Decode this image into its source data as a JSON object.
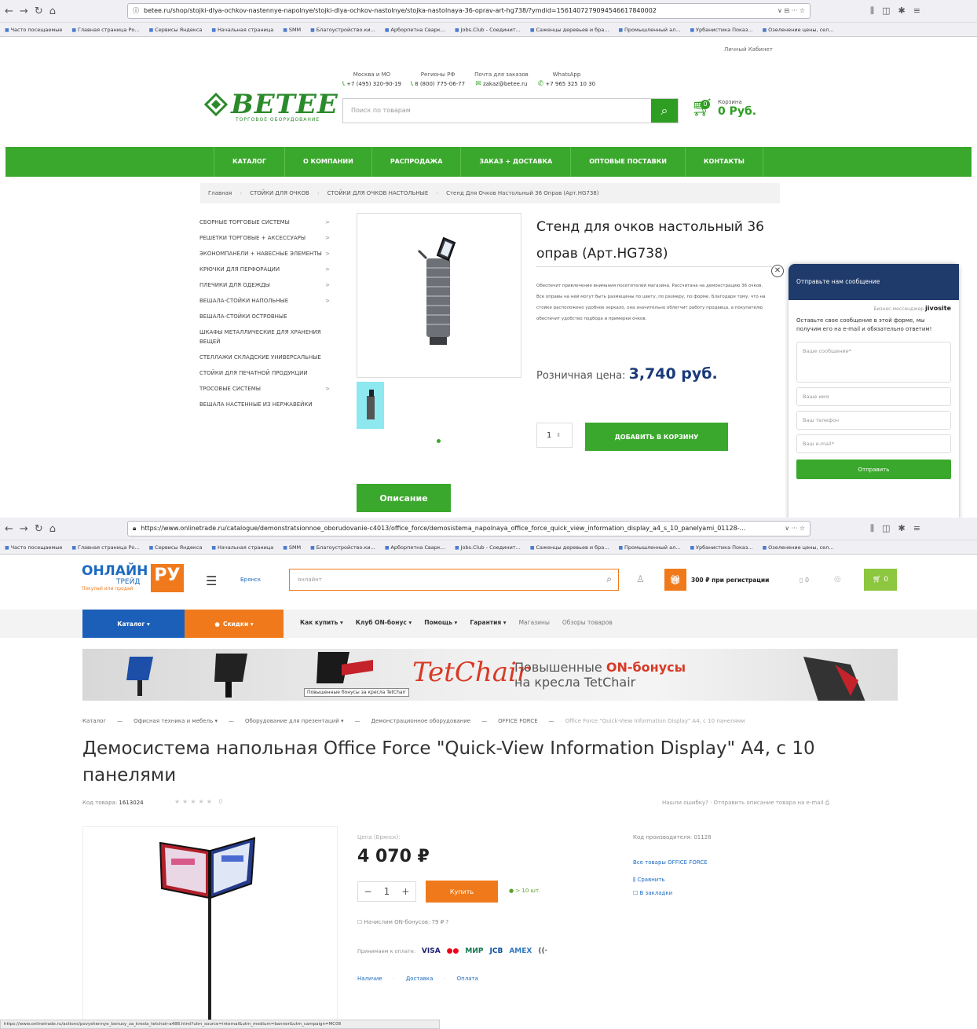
{
  "browser1": {
    "url": "betee.ru/shop/stojki-dlya-ochkov-nastennye-napolnye/stojki-dlya-ochkov-nastolnye/stojka-nastolnaya-36-oprav-art-hg738/?ymdid=1561407279094546617840002",
    "url_counter": "∨ ⊟ ··· ☆"
  },
  "bookmarks": [
    "Часто посещаемые",
    "Главная страница Ро...",
    "Сервисы Яндекса",
    "Начальная страница",
    "SMM",
    "Благоустройство.ки...",
    "Арборпетна Сварк...",
    "Jobs.Club - Соединит...",
    "Саженцы деревьев и бра...",
    "Промышленный ал...",
    "Урбанистика Показ...",
    "Озеленение цены, сел..."
  ],
  "site1": {
    "cabinet": "Личный Кабинет",
    "logo": "BETEE",
    "logo_sub": "ТОРГОВОЕ ОБОРУДОВАНИЕ",
    "contacts": [
      {
        "label": "Москва и МО",
        "value": "+7 (495) 320-90-19"
      },
      {
        "label": "Регионы РФ",
        "value": "8 (800) 775-06-77"
      },
      {
        "label": "Почта для заказов",
        "value": "zakaz@betee.ru"
      },
      {
        "label": "WhatsApp",
        "value": "+7 965 325 10 30"
      }
    ],
    "search_placeholder": "Поиск по товарам",
    "cart_label": "Корзина",
    "cart_count": "0",
    "cart_sum": "0 Руб.",
    "nav": [
      "КАТАЛОГ",
      "О КОМПАНИИ",
      "РАСПРОДАЖА",
      "ЗАКАЗ + ДОСТАВКА",
      "ОПТОВЫЕ ПОСТАВКИ",
      "КОНТАКТЫ"
    ],
    "breadcrumb": [
      "Главная",
      "СТОЙКИ ДЛЯ ОЧКОВ",
      "СТОЙКИ ДЛЯ ОЧКОВ НАСТОЛЬНЫЕ",
      "Стенд Для Очков Настольный 36 Оправ (Арт.HG738)"
    ],
    "categories": [
      {
        "label": "СБОРНЫЕ ТОРГОВЫЕ СИСТЕМЫ",
        "arrow": ">"
      },
      {
        "label": "РЕШЕТКИ ТОРГОВЫЕ + АКСЕССУАРЫ",
        "arrow": ">"
      },
      {
        "label": "ЭКОНОМПАНЕЛИ + НАВЕСНЫЕ ЭЛЕМЕНТЫ",
        "arrow": ">"
      },
      {
        "label": "КРЮЧКИ ДЛЯ ПЕРФОРАЦИИ",
        "arrow": ">"
      },
      {
        "label": "ПЛЕЧИКИ ДЛЯ ОДЕЖДЫ",
        "arrow": ">"
      },
      {
        "label": "ВЕШАЛА-СТОЙКИ НАПОЛЬНЫЕ",
        "arrow": ">"
      },
      {
        "label": "ВЕШАЛА-СТОЙКИ ОСТРОВНЫЕ",
        "arrow": ""
      },
      {
        "label": "ШКАФЫ МЕТАЛЛИЧЕСКИЕ ДЛЯ ХРАНЕНИЯ ВЕЩЕЙ",
        "arrow": ""
      },
      {
        "label": "СТЕЛЛАЖИ СКЛАДСКИЕ УНИВЕРСАЛЬНЫЕ",
        "arrow": ""
      },
      {
        "label": "СТОЙКИ ДЛЯ ПЕЧАТНОЙ ПРОДУКЦИИ",
        "arrow": ""
      },
      {
        "label": "ТРОСОВЫЕ СИСТЕМЫ",
        "arrow": ">"
      },
      {
        "label": "ВЕШАЛА НАСТЕННЫЕ ИЗ НЕРЖАВЕЙКИ",
        "arrow": ""
      }
    ],
    "title": "Стенд для очков настольный 36 оправ (Арт.HG738)",
    "description": "Обеспечит привлечение внимания посетителей магазина. Рассчитана на демонстрацию 36 очков. Все оправы на ней могут быть размещены по цвету, по размеру, по форме. Благодаря тому, что на стойке расположено удобное зеркало, она значительно облегчит работу продавца, а покупателю обеспечит удобство подбора и примерки очков.",
    "price_label": "Розничная цена:",
    "price": "3,740 руб.",
    "qty": "1",
    "add_to_cart": "ДОБАВИТЬ В КОРЗИНУ",
    "tab_description": "Описание"
  },
  "jivo": {
    "header": "Отправьте нам сообщение",
    "powered": "Бизнес-мессенджер",
    "brand": "jivosite",
    "note": "Оставьте свое сообщение в этой форме, мы получим его на e-mail и обязательно ответим!",
    "message_ph": "Ваше сообщение*",
    "name_ph": "Ваше имя",
    "phone_ph": "Ваш телефон",
    "email_ph": "Ваш e-mail*",
    "send": "Отправить"
  },
  "browser2": {
    "url": "https://www.onlinetrade.ru/catalogue/demonstratsionnoe_oborudovanie-c4013/office_force/demosistema_napolnaya_office_force_quick_view_information_display_a4_s_10_panelyami_01128-...",
    "url_counter": "∨ ··· ☆"
  },
  "site2": {
    "logo_main": "ОНЛАЙН",
    "logo_sub": "ТРЕЙД",
    "logo_tag": "Покупай или продай",
    "logo_ru": "РУ",
    "city": "Брянск",
    "search_value": "онлайнт",
    "bonus": "300 ₽ при регистрации",
    "compare_count": "0",
    "cart_count": "0",
    "catalog": "Каталог ▾",
    "sales": "Скидки ▾",
    "nav": [
      "Как купить ▾",
      "Клуб ON-бонус ▾",
      "Помощь ▾",
      "Гарантия ▾"
    ],
    "nav_light": [
      "Магазины",
      "Обзоры товаров"
    ],
    "banner_brand": "TetChair",
    "banner_line1a": "Повышенные",
    "banner_line1b": "ON-бонусы",
    "banner_line2": "на кресла TetChair",
    "banner_tip": "Повышенные бонусы за кресла TetChair",
    "breadcrumb": [
      "Каталог",
      "Офисная техника и мебель ▾",
      "Оборудование для презентаций ▾",
      "Демонстрационное оборудование",
      "OFFICE FORCE"
    ],
    "breadcrumb_current": "Office Force \"Quick-View Information Display\" A4, с 10 панелями",
    "title": "Демосистема напольная Office Force \"Quick-View Information Display\" A4, с 10 панелями",
    "code_label": "Код товара:",
    "code": "1613024",
    "rating_count": "0",
    "error_link": "Нашли ошибку?  ·  Отправить описание товара на e-mail",
    "price_label": "Цена (Брянск):",
    "price": "4 070 ₽",
    "qty": "1",
    "buy": "Купить",
    "stock": "● > 10 шт.",
    "bonuses": "Начислим ON-бонусов: 79 ₽ ?",
    "pay_label": "Принимаем к оплате:",
    "pay_cards": [
      "VISA",
      "●●",
      "МИР",
      "JCB",
      "AMEX",
      "((·"
    ],
    "links": [
      "Наличие",
      "Доставка",
      "Оплата"
    ],
    "maker_code": "Код производителя: 01128",
    "all_brand": "Все товары OFFICE FORCE",
    "compare": "Сравнить",
    "bookmark": "В закладки"
  },
  "statusbar": "https://www.onlinetrade.ru/actions/povyshennye_bonusy_za_kresla_tetchair-a488.html?utm_source=internal&utm_medium=banner&utm_campaign=MC08"
}
